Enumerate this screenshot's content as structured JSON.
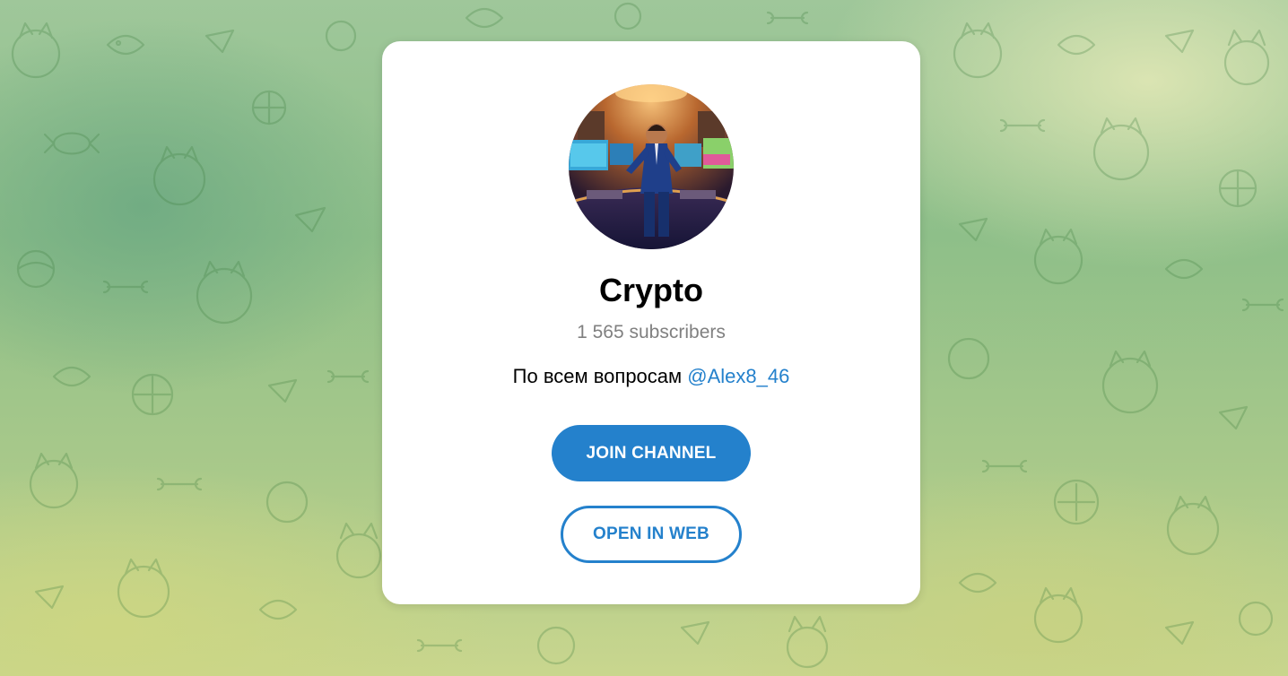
{
  "channel": {
    "title": "Crypto",
    "subscribers": "1 565 subscribers",
    "description_text": "По всем вопросам ",
    "description_link": "@Alex8_46"
  },
  "buttons": {
    "join_label": "JOIN CHANNEL",
    "web_label": "OPEN IN WEB"
  },
  "colors": {
    "accent": "#2481cc",
    "card": "#ffffff",
    "muted_text": "#808080"
  },
  "icons": {
    "avatar": "channel-avatar-image",
    "background": "doodle-pattern"
  }
}
